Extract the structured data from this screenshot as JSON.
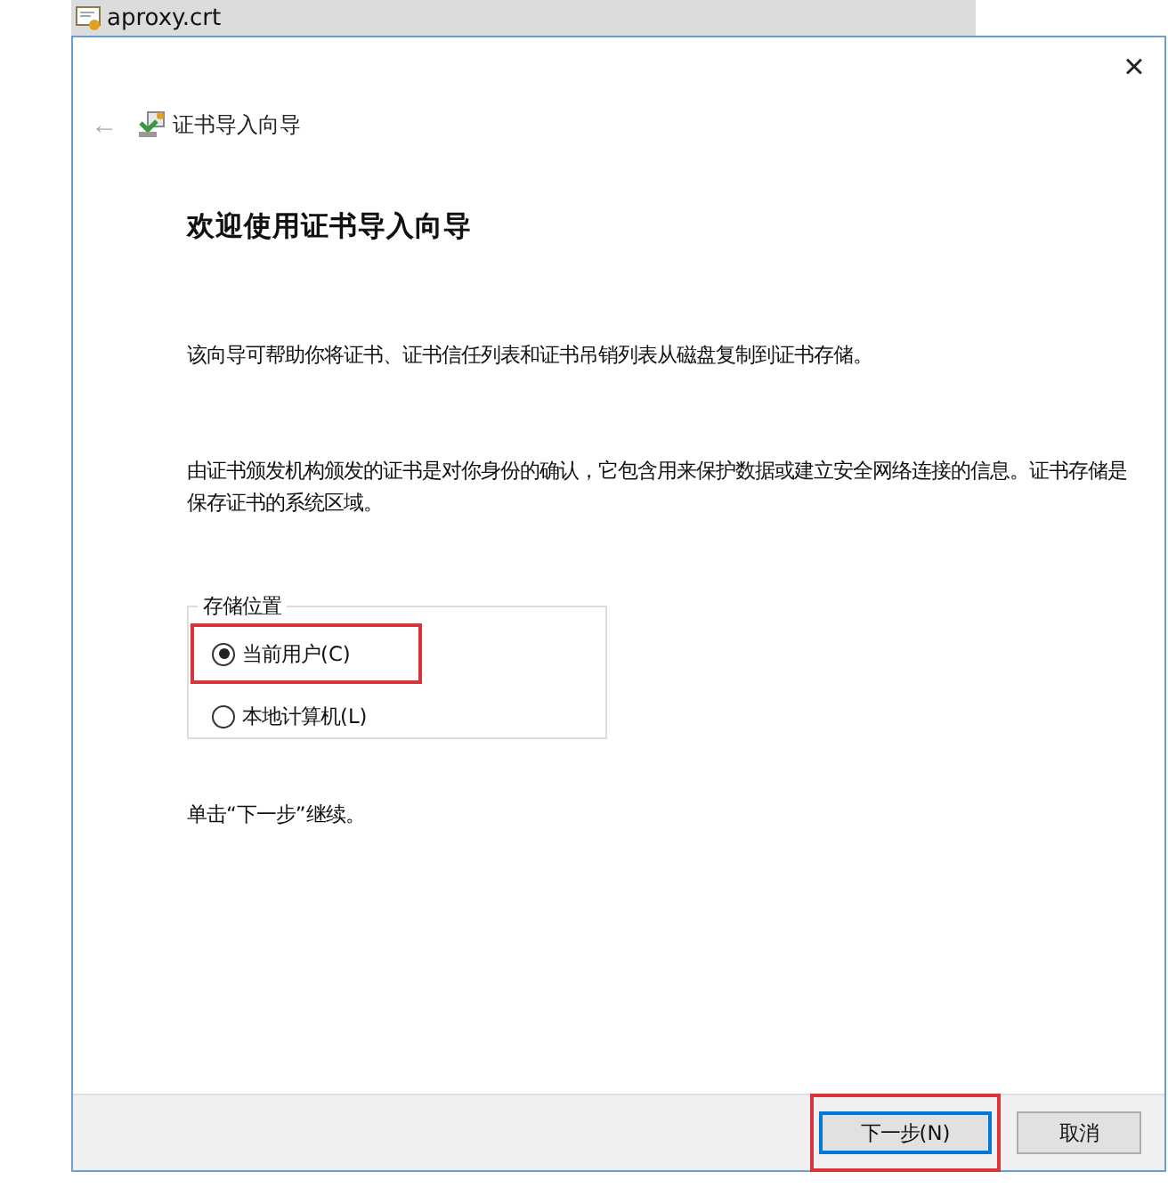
{
  "file_tab": {
    "title": "aproxy.crt"
  },
  "window": {
    "close": "×",
    "back": "←",
    "title": "证书导入向导"
  },
  "heading": "欢迎使用证书导入向导",
  "paragraphs": [
    "该向导可帮助你将证书、证书信任列表和证书吊销列表从磁盘复制到证书存储。",
    "由证书颁发机构颁发的证书是对你身份的确认，它包含用来保护数据或建立安全网络连接的信息。证书存储是保存证书的系统区域。"
  ],
  "store_location": {
    "legend": "存储位置",
    "options": [
      {
        "label": "当前用户(C)",
        "selected": true,
        "highlighted": true
      },
      {
        "label": "本地计算机(L)",
        "selected": false,
        "highlighted": false
      }
    ]
  },
  "hint": "单击“下一步”继续。",
  "buttons": [
    {
      "label": "下一步(N)",
      "default": true,
      "highlighted": true
    },
    {
      "label": "取消",
      "default": false,
      "highlighted": false
    }
  ]
}
